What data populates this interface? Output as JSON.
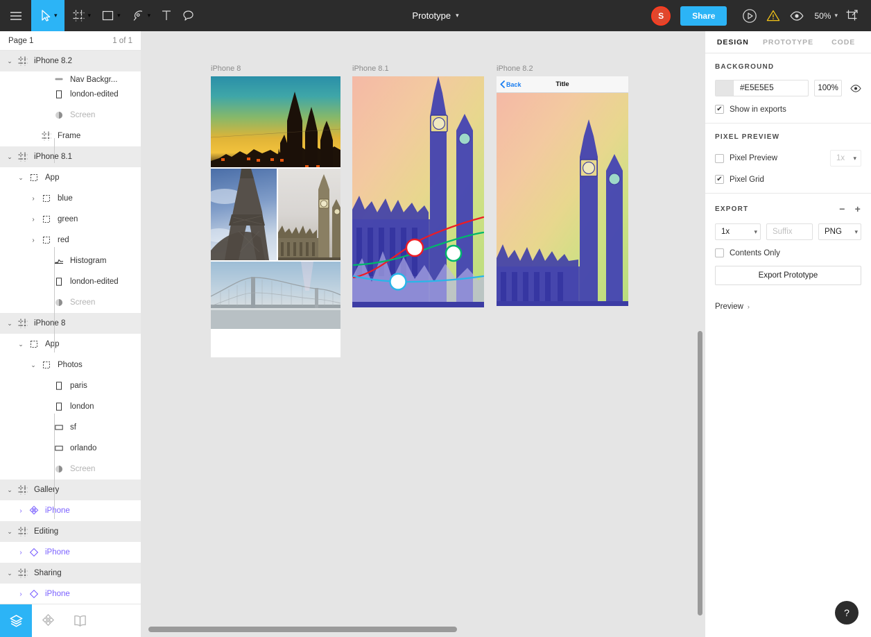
{
  "toolbar": {
    "menu_icon": "hamburger-menu-icon",
    "tools": [
      {
        "name": "move-tool",
        "icon": "cursor-arrow-icon",
        "has_caret": true,
        "active": true
      },
      {
        "name": "frame-tool",
        "icon": "frame-icon",
        "has_caret": true,
        "active": false
      },
      {
        "name": "shape-tool",
        "icon": "square-icon",
        "has_caret": true,
        "active": false
      },
      {
        "name": "pen-tool",
        "icon": "pen-icon",
        "has_caret": true,
        "active": false
      },
      {
        "name": "text-tool",
        "icon": "text-t-icon",
        "has_caret": false,
        "active": false
      },
      {
        "name": "comment-tool",
        "icon": "speech-bubble-icon",
        "has_caret": false,
        "active": false
      }
    ],
    "title": "Prototype",
    "avatar_initial": "S",
    "share_label": "Share",
    "present_icon": "play-circle-icon",
    "warning_icon": "warning-triangle-icon",
    "view_icon": "eye-icon",
    "zoom_label": "50%",
    "export_icon": "crop-export-icon"
  },
  "left_panel": {
    "page_label": "Page 1",
    "page_count": "1 of 1",
    "layers": [
      {
        "label": "iPhone 8.2",
        "type": "frame",
        "depth": 0,
        "arrow": "down",
        "icon": "frame-icon",
        "selected": true
      },
      {
        "label": "Nav Backgr...",
        "type": "rect-fill",
        "depth": 3,
        "arrow": "none",
        "icon": "rect-filled-icon",
        "clipped": true
      },
      {
        "label": "london-edited",
        "type": "rect",
        "depth": 3,
        "arrow": "none",
        "icon": "rect-icon"
      },
      {
        "label": "Screen",
        "type": "blend",
        "depth": 3,
        "arrow": "none",
        "icon": "half-circle-icon",
        "dim": true
      },
      {
        "label": "Frame",
        "type": "frame-child",
        "depth": 2,
        "arrow": "none",
        "icon": "frame-icon"
      },
      {
        "label": "iPhone 8.1",
        "type": "frame",
        "depth": 0,
        "arrow": "down",
        "icon": "frame-icon",
        "selected": true
      },
      {
        "label": "App",
        "type": "group",
        "depth": 1,
        "arrow": "down",
        "icon": "group-icon"
      },
      {
        "label": "blue",
        "type": "group",
        "depth": 2,
        "arrow": "right",
        "icon": "group-icon"
      },
      {
        "label": "green",
        "type": "group",
        "depth": 2,
        "arrow": "right",
        "icon": "group-icon"
      },
      {
        "label": "red",
        "type": "group",
        "depth": 2,
        "arrow": "right",
        "icon": "group-icon"
      },
      {
        "label": "Histogram",
        "type": "vector",
        "depth": 3,
        "arrow": "none",
        "icon": "histogram-icon"
      },
      {
        "label": "london-edited",
        "type": "rect",
        "depth": 3,
        "arrow": "none",
        "icon": "rect-icon"
      },
      {
        "label": "Screen",
        "type": "blend",
        "depth": 3,
        "arrow": "none",
        "icon": "half-circle-icon",
        "dim": true
      },
      {
        "label": "iPhone 8",
        "type": "frame",
        "depth": 0,
        "arrow": "down",
        "icon": "frame-icon",
        "selected": true
      },
      {
        "label": "App",
        "type": "group",
        "depth": 1,
        "arrow": "down",
        "icon": "group-icon"
      },
      {
        "label": "Photos",
        "type": "group",
        "depth": 2,
        "arrow": "down",
        "icon": "group-icon"
      },
      {
        "label": "paris",
        "type": "rect",
        "depth": 3,
        "arrow": "none",
        "icon": "rect-icon"
      },
      {
        "label": "london",
        "type": "rect",
        "depth": 3,
        "arrow": "none",
        "icon": "rect-icon"
      },
      {
        "label": "sf",
        "type": "rect",
        "depth": 3,
        "arrow": "none",
        "icon": "rect-wide-icon"
      },
      {
        "label": "orlando",
        "type": "rect",
        "depth": 3,
        "arrow": "none",
        "icon": "rect-wide-icon"
      },
      {
        "label": "Screen",
        "type": "blend",
        "depth": 3,
        "arrow": "none",
        "icon": "half-circle-icon",
        "dim": true
      },
      {
        "label": "Gallery",
        "type": "frame",
        "depth": 0,
        "arrow": "down",
        "icon": "frame-icon",
        "selected": true
      },
      {
        "label": "iPhone",
        "type": "component-set",
        "depth": 1,
        "arrow": "right",
        "icon": "component-set-icon",
        "purple": true
      },
      {
        "label": "Editing",
        "type": "frame",
        "depth": 0,
        "arrow": "down",
        "icon": "frame-icon",
        "selected": true
      },
      {
        "label": "iPhone",
        "type": "instance",
        "depth": 1,
        "arrow": "right",
        "icon": "diamond-icon",
        "purple": true
      },
      {
        "label": "Sharing",
        "type": "frame",
        "depth": 0,
        "arrow": "down",
        "icon": "frame-icon",
        "selected": true
      },
      {
        "label": "iPhone",
        "type": "instance",
        "depth": 1,
        "arrow": "right",
        "icon": "diamond-icon",
        "purple": true
      }
    ],
    "bottom_tabs": [
      {
        "name": "layers-tab",
        "icon": "layers-stack-icon",
        "selected": true
      },
      {
        "name": "components-tab",
        "icon": "component-set-icon",
        "selected": false
      },
      {
        "name": "library-tab",
        "icon": "book-icon",
        "selected": false
      }
    ]
  },
  "canvas": {
    "boards": [
      {
        "name": "iPhone 8",
        "kind": "photo-grid",
        "photos": [
          {
            "name": "orlando",
            "caption": "castle-at-sunset"
          },
          {
            "name": "paris",
            "caption": "eiffel-tower"
          },
          {
            "name": "london",
            "caption": "big-ben-westminster"
          },
          {
            "name": "sf",
            "caption": "golden-gate-bridge"
          }
        ]
      },
      {
        "name": "iPhone 8.1",
        "kind": "curve-editor",
        "photo": "london-edited",
        "curves": [
          {
            "channel": "red",
            "color": "#ee1b24",
            "handle_color": "#ee1b24"
          },
          {
            "channel": "green",
            "color": "#00b86b",
            "handle_color": "#00b86b"
          },
          {
            "channel": "blue",
            "color": "#29b6e8",
            "handle_color": "#29b6e8"
          }
        ],
        "histogram_color": "#3f3fa8"
      },
      {
        "name": "iPhone 8.2",
        "kind": "detail-view",
        "nav_back_label": "Back",
        "nav_title": "Title",
        "photo": "london-edited"
      }
    ]
  },
  "right_panel": {
    "tabs": [
      {
        "label": "DESIGN",
        "selected": true
      },
      {
        "label": "PROTOTYPE",
        "selected": false
      },
      {
        "label": "CODE",
        "selected": false
      }
    ],
    "background": {
      "heading": "BACKGROUND",
      "color_value": "#E5E5E5",
      "swatch_color": "#E5E5E5",
      "opacity": "100%",
      "visibility_icon": "eye-icon",
      "show_in_exports_label": "Show in exports",
      "show_in_exports_checked": true
    },
    "pixel_preview": {
      "heading": "PIXEL PREVIEW",
      "pixel_preview_label": "Pixel Preview",
      "pixel_preview_checked": false,
      "pixel_preview_scale": "1x",
      "pixel_grid_label": "Pixel Grid",
      "pixel_grid_checked": true
    },
    "export": {
      "heading": "EXPORT",
      "remove_icon": "minus-icon",
      "add_icon": "plus-icon",
      "scale": "1x",
      "suffix_placeholder": "Suffix",
      "format": "PNG",
      "contents_only_label": "Contents Only",
      "contents_only_checked": false,
      "export_button_label": "Export Prototype",
      "preview_label": "Preview"
    }
  },
  "help": {
    "icon": "question-mark-icon",
    "label": "?"
  }
}
